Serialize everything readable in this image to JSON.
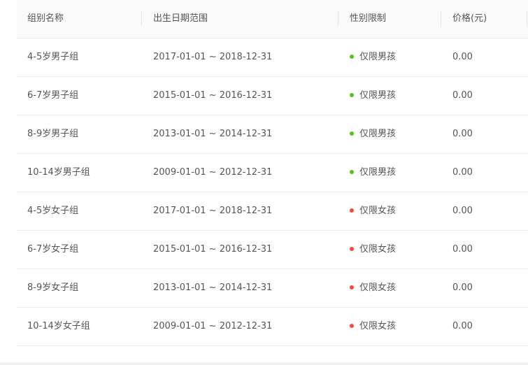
{
  "table": {
    "headers": [
      "组别名称",
      "出生日期范围",
      "性别限制",
      "价格(元)"
    ],
    "rows": [
      {
        "name": "4-5岁男子组",
        "range": "2017-01-01 ~ 2018-12-31",
        "gender": "仅限男孩",
        "price": "0.00",
        "gender_color": "#52c41a"
      },
      {
        "name": "6-7岁男子组",
        "range": "2015-01-01 ~ 2016-12-31",
        "gender": "仅限男孩",
        "price": "0.00",
        "gender_color": "#52c41a"
      },
      {
        "name": "8-9岁男子组",
        "range": "2013-01-01 ~ 2014-12-31",
        "gender": "仅限男孩",
        "price": "0.00",
        "gender_color": "#52c41a"
      },
      {
        "name": "10-14岁男子组",
        "range": "2009-01-01 ~ 2012-12-31",
        "gender": "仅限男孩",
        "price": "0.00",
        "gender_color": "#52c41a"
      },
      {
        "name": "4-5岁女子组",
        "range": "2017-01-01 ~ 2018-12-31",
        "gender": "仅限女孩",
        "price": "0.00",
        "gender_color": "#f5483b"
      },
      {
        "name": "6-7岁女子组",
        "range": "2015-01-01 ~ 2016-12-31",
        "gender": "仅限女孩",
        "price": "0.00",
        "gender_color": "#f5483b"
      },
      {
        "name": "8-9岁女子组",
        "range": "2013-01-01 ~ 2014-12-31",
        "gender": "仅限女孩",
        "price": "0.00",
        "gender_color": "#f5483b"
      },
      {
        "name": "10-14岁女子组",
        "range": "2009-01-01 ~ 2012-12-31",
        "gender": "仅限女孩",
        "price": "0.00",
        "gender_color": "#f5483b"
      }
    ]
  }
}
